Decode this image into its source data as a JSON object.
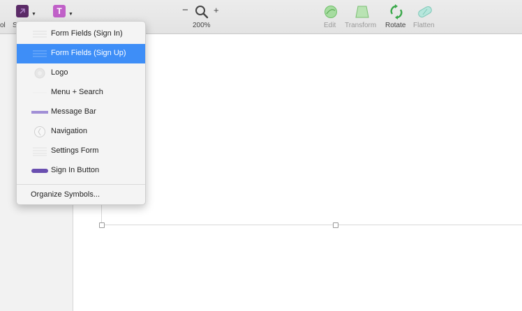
{
  "toolbar": {
    "left_label_fragment": "ol",
    "symbols_label_fragment": "S",
    "zoom_minus": "−",
    "zoom_plus": "+",
    "zoom_level": "200%",
    "edit_label": "Edit",
    "transform_label": "Transform",
    "rotate_label": "Rotate",
    "flatten_label": "Flatten",
    "text_button": "T"
  },
  "symbols_menu": {
    "items": [
      {
        "label": "Form Fields (Sign In)",
        "icon": "lines-thumb",
        "selected": false
      },
      {
        "label": "Form Fields (Sign Up)",
        "icon": "lines-thumb",
        "selected": true
      },
      {
        "label": "Logo",
        "icon": "logo-thumb",
        "selected": false
      },
      {
        "label": "Menu + Search",
        "icon": "blank-thumb",
        "selected": false
      },
      {
        "label": "Message Bar",
        "icon": "bar-thumb",
        "selected": false
      },
      {
        "label": "Navigation",
        "icon": "navigation-thumb",
        "selected": false
      },
      {
        "label": "Settings Form",
        "icon": "lines-thumb",
        "selected": false
      },
      {
        "label": "Sign In Button",
        "icon": "button-thumb",
        "selected": false
      }
    ],
    "organize_label": "Organize Symbols..."
  },
  "colors": {
    "selection": "#3e8ef7",
    "message_bar": "#a18fd6",
    "sign_in_button": "#6a4fb0",
    "edit_icon": "#7fcf7a",
    "rotate_icon": "#3aa84a",
    "flatten_icon": "#7fd0c0"
  }
}
